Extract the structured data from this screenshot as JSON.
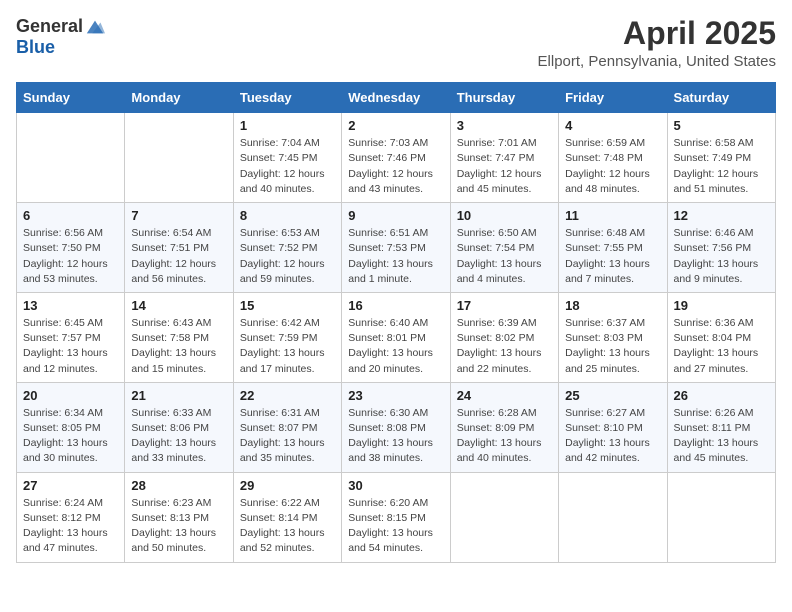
{
  "header": {
    "logo_general": "General",
    "logo_blue": "Blue",
    "title": "April 2025",
    "location": "Ellport, Pennsylvania, United States"
  },
  "weekdays": [
    "Sunday",
    "Monday",
    "Tuesday",
    "Wednesday",
    "Thursday",
    "Friday",
    "Saturday"
  ],
  "weeks": [
    [
      null,
      null,
      {
        "day": 1,
        "sunrise": "Sunrise: 7:04 AM",
        "sunset": "Sunset: 7:45 PM",
        "daylight": "Daylight: 12 hours and 40 minutes."
      },
      {
        "day": 2,
        "sunrise": "Sunrise: 7:03 AM",
        "sunset": "Sunset: 7:46 PM",
        "daylight": "Daylight: 12 hours and 43 minutes."
      },
      {
        "day": 3,
        "sunrise": "Sunrise: 7:01 AM",
        "sunset": "Sunset: 7:47 PM",
        "daylight": "Daylight: 12 hours and 45 minutes."
      },
      {
        "day": 4,
        "sunrise": "Sunrise: 6:59 AM",
        "sunset": "Sunset: 7:48 PM",
        "daylight": "Daylight: 12 hours and 48 minutes."
      },
      {
        "day": 5,
        "sunrise": "Sunrise: 6:58 AM",
        "sunset": "Sunset: 7:49 PM",
        "daylight": "Daylight: 12 hours and 51 minutes."
      }
    ],
    [
      {
        "day": 6,
        "sunrise": "Sunrise: 6:56 AM",
        "sunset": "Sunset: 7:50 PM",
        "daylight": "Daylight: 12 hours and 53 minutes."
      },
      {
        "day": 7,
        "sunrise": "Sunrise: 6:54 AM",
        "sunset": "Sunset: 7:51 PM",
        "daylight": "Daylight: 12 hours and 56 minutes."
      },
      {
        "day": 8,
        "sunrise": "Sunrise: 6:53 AM",
        "sunset": "Sunset: 7:52 PM",
        "daylight": "Daylight: 12 hours and 59 minutes."
      },
      {
        "day": 9,
        "sunrise": "Sunrise: 6:51 AM",
        "sunset": "Sunset: 7:53 PM",
        "daylight": "Daylight: 13 hours and 1 minute."
      },
      {
        "day": 10,
        "sunrise": "Sunrise: 6:50 AM",
        "sunset": "Sunset: 7:54 PM",
        "daylight": "Daylight: 13 hours and 4 minutes."
      },
      {
        "day": 11,
        "sunrise": "Sunrise: 6:48 AM",
        "sunset": "Sunset: 7:55 PM",
        "daylight": "Daylight: 13 hours and 7 minutes."
      },
      {
        "day": 12,
        "sunrise": "Sunrise: 6:46 AM",
        "sunset": "Sunset: 7:56 PM",
        "daylight": "Daylight: 13 hours and 9 minutes."
      }
    ],
    [
      {
        "day": 13,
        "sunrise": "Sunrise: 6:45 AM",
        "sunset": "Sunset: 7:57 PM",
        "daylight": "Daylight: 13 hours and 12 minutes."
      },
      {
        "day": 14,
        "sunrise": "Sunrise: 6:43 AM",
        "sunset": "Sunset: 7:58 PM",
        "daylight": "Daylight: 13 hours and 15 minutes."
      },
      {
        "day": 15,
        "sunrise": "Sunrise: 6:42 AM",
        "sunset": "Sunset: 7:59 PM",
        "daylight": "Daylight: 13 hours and 17 minutes."
      },
      {
        "day": 16,
        "sunrise": "Sunrise: 6:40 AM",
        "sunset": "Sunset: 8:01 PM",
        "daylight": "Daylight: 13 hours and 20 minutes."
      },
      {
        "day": 17,
        "sunrise": "Sunrise: 6:39 AM",
        "sunset": "Sunset: 8:02 PM",
        "daylight": "Daylight: 13 hours and 22 minutes."
      },
      {
        "day": 18,
        "sunrise": "Sunrise: 6:37 AM",
        "sunset": "Sunset: 8:03 PM",
        "daylight": "Daylight: 13 hours and 25 minutes."
      },
      {
        "day": 19,
        "sunrise": "Sunrise: 6:36 AM",
        "sunset": "Sunset: 8:04 PM",
        "daylight": "Daylight: 13 hours and 27 minutes."
      }
    ],
    [
      {
        "day": 20,
        "sunrise": "Sunrise: 6:34 AM",
        "sunset": "Sunset: 8:05 PM",
        "daylight": "Daylight: 13 hours and 30 minutes."
      },
      {
        "day": 21,
        "sunrise": "Sunrise: 6:33 AM",
        "sunset": "Sunset: 8:06 PM",
        "daylight": "Daylight: 13 hours and 33 minutes."
      },
      {
        "day": 22,
        "sunrise": "Sunrise: 6:31 AM",
        "sunset": "Sunset: 8:07 PM",
        "daylight": "Daylight: 13 hours and 35 minutes."
      },
      {
        "day": 23,
        "sunrise": "Sunrise: 6:30 AM",
        "sunset": "Sunset: 8:08 PM",
        "daylight": "Daylight: 13 hours and 38 minutes."
      },
      {
        "day": 24,
        "sunrise": "Sunrise: 6:28 AM",
        "sunset": "Sunset: 8:09 PM",
        "daylight": "Daylight: 13 hours and 40 minutes."
      },
      {
        "day": 25,
        "sunrise": "Sunrise: 6:27 AM",
        "sunset": "Sunset: 8:10 PM",
        "daylight": "Daylight: 13 hours and 42 minutes."
      },
      {
        "day": 26,
        "sunrise": "Sunrise: 6:26 AM",
        "sunset": "Sunset: 8:11 PM",
        "daylight": "Daylight: 13 hours and 45 minutes."
      }
    ],
    [
      {
        "day": 27,
        "sunrise": "Sunrise: 6:24 AM",
        "sunset": "Sunset: 8:12 PM",
        "daylight": "Daylight: 13 hours and 47 minutes."
      },
      {
        "day": 28,
        "sunrise": "Sunrise: 6:23 AM",
        "sunset": "Sunset: 8:13 PM",
        "daylight": "Daylight: 13 hours and 50 minutes."
      },
      {
        "day": 29,
        "sunrise": "Sunrise: 6:22 AM",
        "sunset": "Sunset: 8:14 PM",
        "daylight": "Daylight: 13 hours and 52 minutes."
      },
      {
        "day": 30,
        "sunrise": "Sunrise: 6:20 AM",
        "sunset": "Sunset: 8:15 PM",
        "daylight": "Daylight: 13 hours and 54 minutes."
      },
      null,
      null,
      null
    ]
  ]
}
